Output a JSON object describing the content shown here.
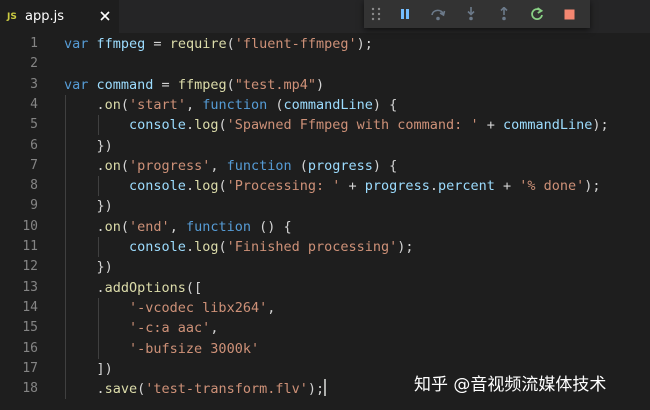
{
  "tab": {
    "icon_label": "JS",
    "filename": "app.js",
    "close_glyph": "✕"
  },
  "debug_toolbar": {
    "buttons": [
      "pause",
      "step-over",
      "step-into",
      "step-out",
      "restart",
      "stop"
    ]
  },
  "editor": {
    "lines": [
      {
        "n": "1",
        "t": [
          [
            "k",
            "var "
          ],
          [
            "v",
            "ffmpeg"
          ],
          [
            "p",
            " = "
          ],
          [
            "f",
            "require"
          ],
          [
            "p",
            "("
          ],
          [
            "s",
            "'fluent-ffmpeg'"
          ],
          [
            "p",
            ");"
          ]
        ]
      },
      {
        "n": "2",
        "t": []
      },
      {
        "n": "3",
        "t": [
          [
            "k",
            "var "
          ],
          [
            "v",
            "command"
          ],
          [
            "p",
            " = "
          ],
          [
            "f",
            "ffmpeg"
          ],
          [
            "p",
            "("
          ],
          [
            "s",
            "\"test.mp4\""
          ],
          [
            "p",
            ")"
          ]
        ]
      },
      {
        "n": "4",
        "t": [
          [
            "p",
            "    ."
          ],
          [
            "f",
            "on"
          ],
          [
            "p",
            "("
          ],
          [
            "s",
            "'start'"
          ],
          [
            "p",
            ", "
          ],
          [
            "k",
            "function"
          ],
          [
            "p",
            " ("
          ],
          [
            "v",
            "commandLine"
          ],
          [
            "p",
            ") {"
          ]
        ]
      },
      {
        "n": "5",
        "t": [
          [
            "p",
            "        "
          ],
          [
            "v",
            "console"
          ],
          [
            "p",
            "."
          ],
          [
            "f",
            "log"
          ],
          [
            "p",
            "("
          ],
          [
            "s",
            "'Spawned Ffmpeg with command: '"
          ],
          [
            "p",
            " + "
          ],
          [
            "v",
            "commandLine"
          ],
          [
            "p",
            ");"
          ]
        ]
      },
      {
        "n": "6",
        "t": [
          [
            "p",
            "    })"
          ]
        ]
      },
      {
        "n": "7",
        "t": [
          [
            "p",
            "    ."
          ],
          [
            "f",
            "on"
          ],
          [
            "p",
            "("
          ],
          [
            "s",
            "'progress'"
          ],
          [
            "p",
            ", "
          ],
          [
            "k",
            "function"
          ],
          [
            "p",
            " ("
          ],
          [
            "v",
            "progress"
          ],
          [
            "p",
            ") {"
          ]
        ]
      },
      {
        "n": "8",
        "t": [
          [
            "p",
            "        "
          ],
          [
            "v",
            "console"
          ],
          [
            "p",
            "."
          ],
          [
            "f",
            "log"
          ],
          [
            "p",
            "("
          ],
          [
            "s",
            "'Processing: '"
          ],
          [
            "p",
            " + "
          ],
          [
            "v",
            "progress"
          ],
          [
            "p",
            "."
          ],
          [
            "v",
            "percent"
          ],
          [
            "p",
            " + "
          ],
          [
            "s",
            "'% done'"
          ],
          [
            "p",
            ");"
          ]
        ]
      },
      {
        "n": "9",
        "t": [
          [
            "p",
            "    })"
          ]
        ]
      },
      {
        "n": "10",
        "t": [
          [
            "p",
            "    ."
          ],
          [
            "f",
            "on"
          ],
          [
            "p",
            "("
          ],
          [
            "s",
            "'end'"
          ],
          [
            "p",
            ", "
          ],
          [
            "k",
            "function"
          ],
          [
            "p",
            " () {"
          ]
        ]
      },
      {
        "n": "11",
        "t": [
          [
            "p",
            "        "
          ],
          [
            "v",
            "console"
          ],
          [
            "p",
            "."
          ],
          [
            "f",
            "log"
          ],
          [
            "p",
            "("
          ],
          [
            "s",
            "'Finished processing'"
          ],
          [
            "p",
            ");"
          ]
        ]
      },
      {
        "n": "12",
        "t": [
          [
            "p",
            "    })"
          ]
        ]
      },
      {
        "n": "13",
        "t": [
          [
            "p",
            "    ."
          ],
          [
            "f",
            "addOptions"
          ],
          [
            "p",
            "(["
          ]
        ]
      },
      {
        "n": "14",
        "t": [
          [
            "p",
            "        "
          ],
          [
            "s",
            "'-vcodec libx264'"
          ],
          [
            "p",
            ","
          ]
        ]
      },
      {
        "n": "15",
        "t": [
          [
            "p",
            "        "
          ],
          [
            "s",
            "'-c:a aac'"
          ],
          [
            "p",
            ","
          ]
        ]
      },
      {
        "n": "16",
        "t": [
          [
            "p",
            "        "
          ],
          [
            "s",
            "'-bufsize 3000k'"
          ]
        ]
      },
      {
        "n": "17",
        "t": [
          [
            "p",
            "    ])"
          ]
        ]
      },
      {
        "n": "18",
        "t": [
          [
            "p",
            "    ."
          ],
          [
            "f",
            "save"
          ],
          [
            "p",
            "("
          ],
          [
            "s",
            "'test-transform.flv'"
          ],
          [
            "p",
            ");"
          ]
        ]
      }
    ]
  },
  "watermark": "知乎 @音视频流媒体技术",
  "colors": {
    "keyword": "#569cd6",
    "variable": "#9cdcfe",
    "function": "#dcdcaa",
    "string": "#ce9178",
    "pause": "#75beff",
    "restart": "#89d185",
    "stop": "#f48771"
  }
}
